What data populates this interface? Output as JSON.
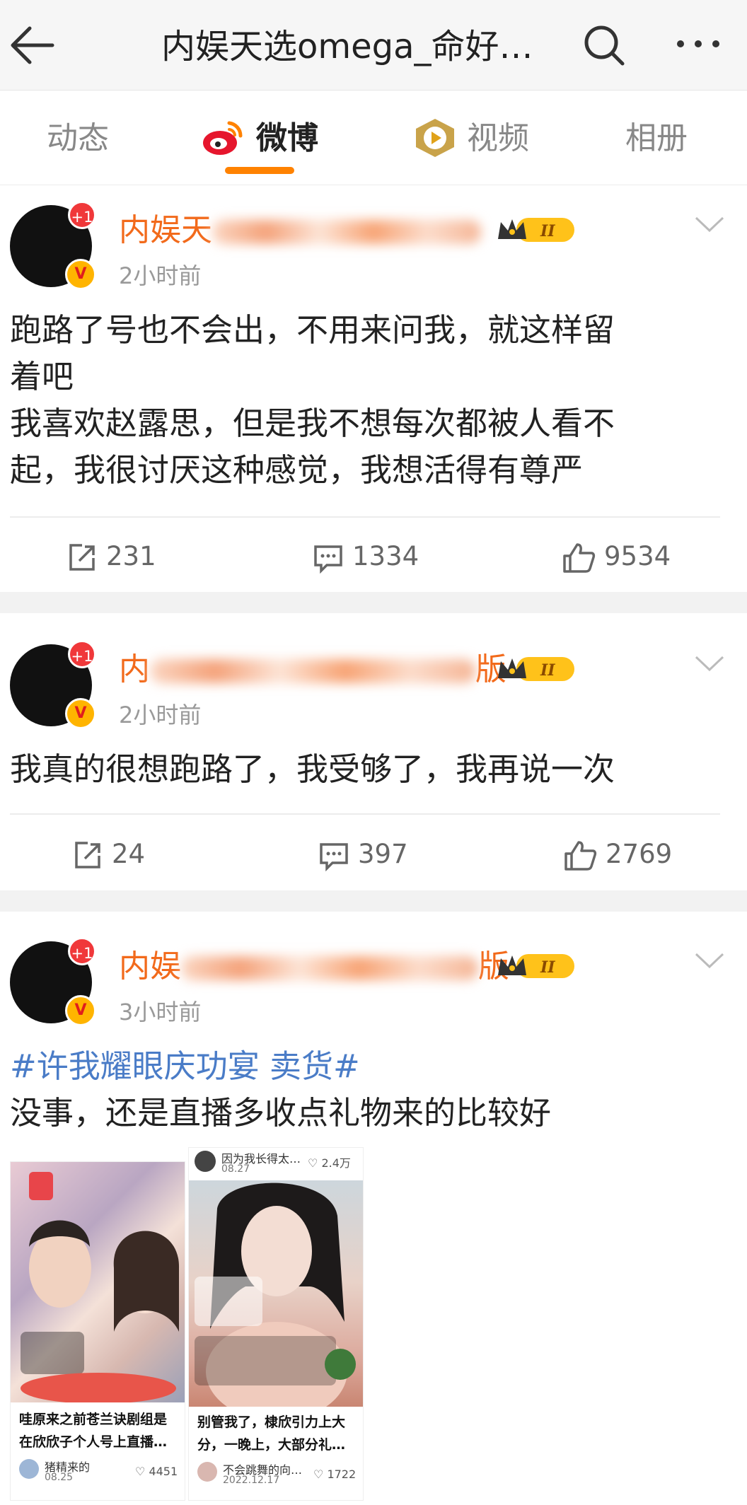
{
  "header": {
    "title": "内娱天选omega_命好…",
    "back_icon": "back-arrow-icon",
    "search_icon": "search-icon",
    "more_icon": "more-dots-icon"
  },
  "tabs": [
    {
      "label": "动态",
      "active": false
    },
    {
      "label": "微博",
      "active": true
    },
    {
      "label": "视频",
      "active": false
    },
    {
      "label": "相册",
      "active": false
    }
  ],
  "colors": {
    "accent": "#ff8200",
    "username": "#f26a1b",
    "topic": "#4a7cc7",
    "badge": "#f0383a"
  },
  "posts": [
    {
      "username_visible": "内娱天",
      "avatar_badge": "+1",
      "verified_mark": "V",
      "vip_level": "II",
      "time": "2小时前",
      "text_lines": [
        "跑路了号也不会出，不用来问我，就这样留",
        "着吧",
        "我喜欢赵露思，但是我不想每次都被人看不",
        "起，我很讨厌这种感觉，我想活得有尊严"
      ],
      "reposts": "231",
      "comments": "1334",
      "likes": "9534"
    },
    {
      "username_visible": "内",
      "username_suffix": "版",
      "avatar_badge": "+1",
      "verified_mark": "V",
      "vip_level": "II",
      "time": "2小时前",
      "text_lines": [
        "我真的很想跑路了，我受够了，我再说一次"
      ],
      "reposts": "24",
      "comments": "397",
      "likes": "2769"
    },
    {
      "username_visible": "内娱",
      "username_suffix": "版",
      "avatar_badge": "+1",
      "verified_mark": "V",
      "vip_level": "II",
      "time": "3小时前",
      "topic": "#许我耀眼庆功宴 卖货#",
      "text_lines": [
        "没事，还是直播多收点礼物来的比较好"
      ],
      "images": [
        {
          "caption_lines": [
            "哇原来之前苍兰诀剧组是",
            "在欣欣子个人号上直播…"
          ],
          "author": "猪精来的",
          "date": "08.25",
          "likes": "4451"
        },
        {
          "top_text": "因为我长得太…",
          "top_date": "08.27",
          "top_likes": "2.4万",
          "caption_lines": [
            "别管我了，棣欣引力上大",
            "分，一晚上，大部分礼…"
          ],
          "author": "不会跳舞的向…",
          "date": "2022.12.17",
          "likes": "1722"
        }
      ]
    }
  ]
}
